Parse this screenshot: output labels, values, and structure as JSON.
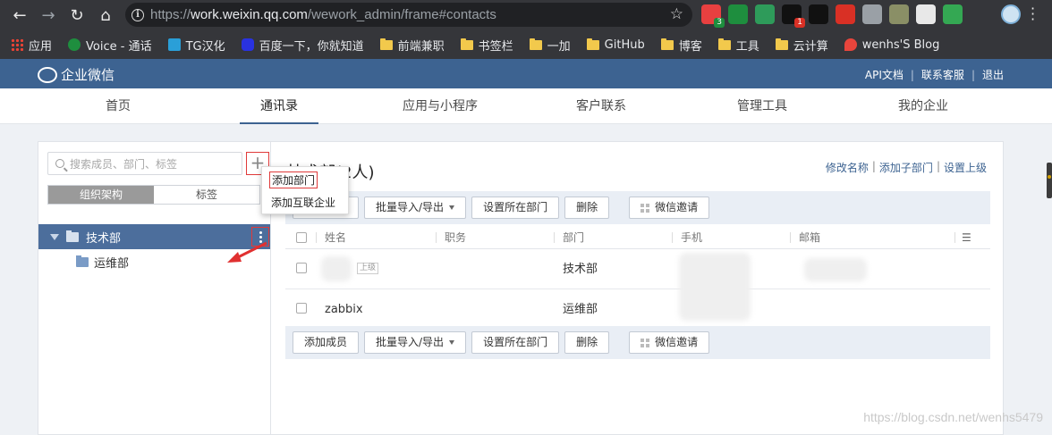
{
  "browser": {
    "url_scheme": "https://",
    "url_host": "work.weixin.qq.com",
    "url_path": "/wework_admin/frame#contacts",
    "extensions": [
      {
        "icon": "balloon-icon",
        "color": "#e84040",
        "badge": "3",
        "badge_color": "#1e8e3e"
      },
      {
        "icon": "leaf-icon",
        "color": "#1e8e3e",
        "badge": "",
        "badge_color": ""
      },
      {
        "icon": "green-g-icon",
        "color": "#2e9b5a",
        "badge": "",
        "badge_color": ""
      },
      {
        "icon": "dark-square-icon",
        "color": "#111",
        "badge": "1",
        "badge_color": "#d93025"
      },
      {
        "icon": "key-icon",
        "color": "#111",
        "badge": "",
        "badge_color": ""
      },
      {
        "icon": "youtube-icon",
        "color": "#d93025",
        "badge": "",
        "badge_color": ""
      },
      {
        "icon": "list-icon",
        "color": "#9aa0a6",
        "badge": "",
        "badge_color": ""
      },
      {
        "icon": "shield-icon",
        "color": "#8a8f66",
        "badge": "",
        "badge_color": ""
      },
      {
        "icon": "gauge-icon",
        "color": "#e8e8e8",
        "badge": "",
        "badge_color": ""
      },
      {
        "icon": "c-icon",
        "color": "#34a853",
        "badge": "",
        "badge_color": ""
      }
    ],
    "bookmarks": [
      {
        "label": "应用",
        "icon": "apps-grid-icon"
      },
      {
        "label": "Voice - 通话",
        "icon": "phone-icon"
      },
      {
        "label": "TG汉化",
        "icon": "tg-icon"
      },
      {
        "label": "百度一下，你就知道",
        "icon": "baidu-icon"
      },
      {
        "label": "前端兼职",
        "icon": "folder-icon"
      },
      {
        "label": "书签栏",
        "icon": "folder-icon"
      },
      {
        "label": "一加",
        "icon": "folder-icon"
      },
      {
        "label": "GitHub",
        "icon": "folder-icon"
      },
      {
        "label": "博客",
        "icon": "folder-icon"
      },
      {
        "label": "工具",
        "icon": "folder-icon"
      },
      {
        "label": "云计算",
        "icon": "folder-icon"
      },
      {
        "label": "wenhs'S Blog",
        "icon": "flame-icon"
      }
    ]
  },
  "header": {
    "logo_text": "企业微信",
    "links": [
      "API文档",
      "联系客服",
      "退出"
    ]
  },
  "topnav": {
    "tabs": [
      {
        "label": "首页",
        "active": false
      },
      {
        "label": "通讯录",
        "active": true
      },
      {
        "label": "应用与小程序",
        "active": false
      },
      {
        "label": "客户联系",
        "active": false
      },
      {
        "label": "管理工具",
        "active": false
      },
      {
        "label": "我的企业",
        "active": false
      }
    ]
  },
  "left": {
    "search_placeholder": "搜索成员、部门、标签",
    "plus": "+",
    "segments": [
      "组织架构",
      "标签"
    ],
    "tree": [
      {
        "label": "技术部",
        "selected": true
      },
      {
        "label": "运维部",
        "selected": false
      }
    ]
  },
  "dropdown": {
    "items": [
      "添加部门",
      "添加互联企业"
    ]
  },
  "right": {
    "title": "技术部(2人)",
    "links": [
      "修改名称",
      "添加子部门",
      "设置上级"
    ],
    "toolbar": [
      "添加成员",
      "批量导入/导出",
      "设置所在部门",
      "删除",
      "微信邀请"
    ],
    "columns": [
      "姓名",
      "职务",
      "部门",
      "手机",
      "邮箱"
    ],
    "rows": [
      {
        "name": "",
        "tag": "上级",
        "title": "",
        "dept": "技术部",
        "phone": "",
        "email": ""
      },
      {
        "name": "zabbix",
        "tag": "",
        "title": "",
        "dept": "运维部",
        "phone": "",
        "email": ""
      }
    ]
  },
  "watermark": "https://blog.csdn.net/wenhs5479"
}
